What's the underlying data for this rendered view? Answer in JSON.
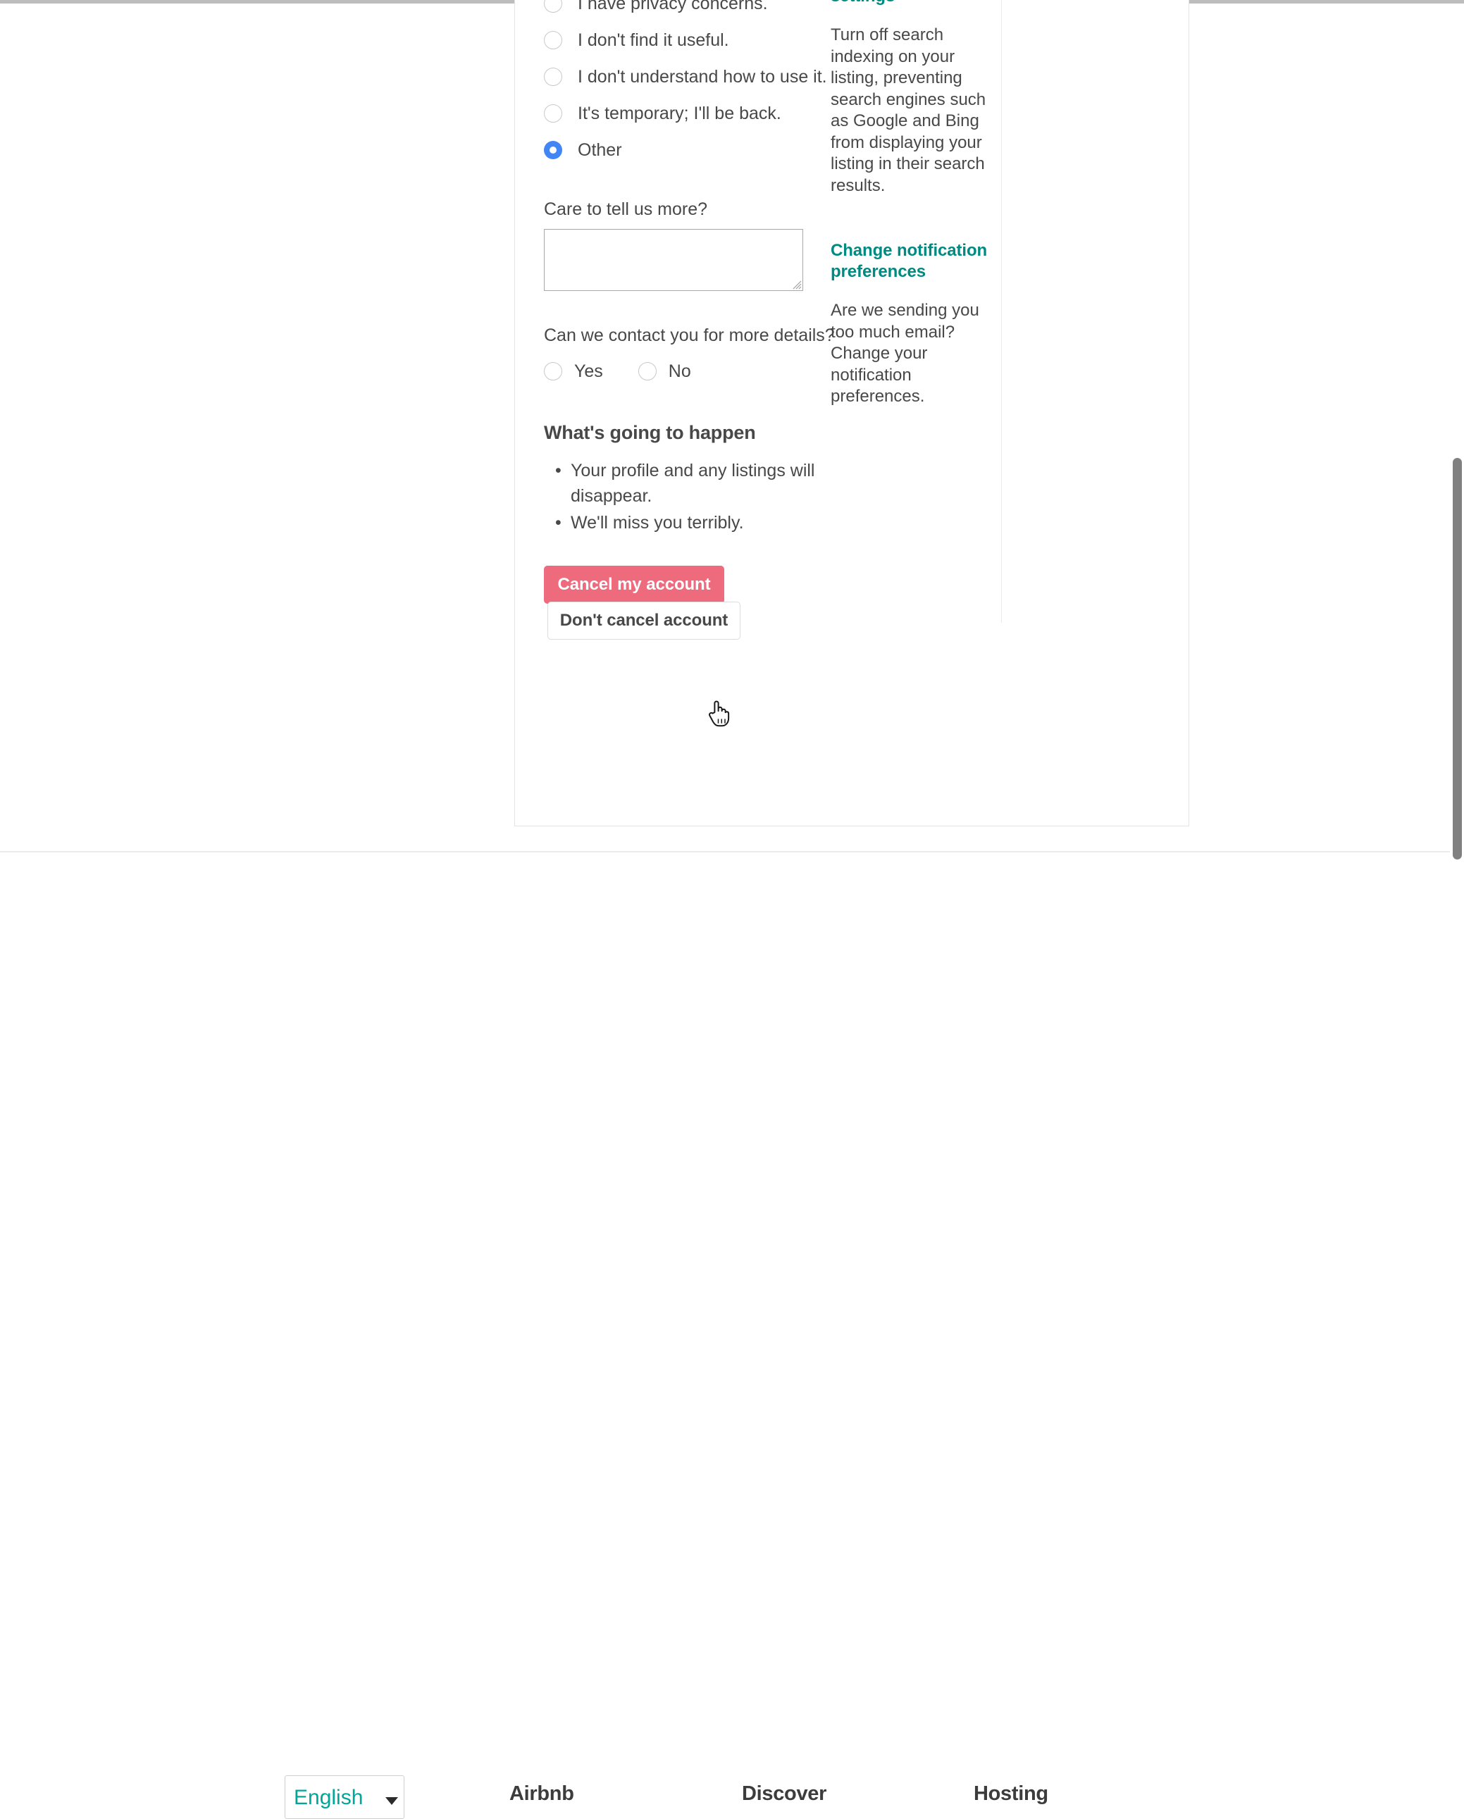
{
  "page": {
    "language_select": {
      "value": "English",
      "options": [
        "English"
      ]
    }
  },
  "card": {
    "reasons": [
      {
        "label": "I have privacy concerns.",
        "selected": false
      },
      {
        "label": "I don't find it useful.",
        "selected": false
      },
      {
        "label": "I don't understand how to use it.",
        "selected": false
      },
      {
        "label": "It's temporary; I'll be back.",
        "selected": false
      },
      {
        "label": "Other",
        "selected": true
      }
    ],
    "more_label": "Care to tell us more?",
    "more_value": "",
    "more_placeholder": "",
    "contact_question": "Can we contact you for more details?",
    "contact_options": [
      {
        "label": "Yes",
        "selected": false
      },
      {
        "label": "No",
        "selected": false
      }
    ],
    "happen_title": "What's going to happen",
    "happen_items": [
      "Your profile and any listings will disappear.",
      "We'll miss you terribly."
    ],
    "cancel_button": "Cancel my account",
    "keep_button": "Don't cancel account"
  },
  "aside": {
    "blocks": [
      {
        "link": "settings",
        "text": "Turn off search indexing on your listing, preventing search engines such as Google and Bing from displaying your listing in their search results."
      },
      {
        "link": "Change notification preferences",
        "text": "Are we sending you too much email? Change your notification preferences."
      }
    ]
  },
  "footer": {
    "columns": [
      {
        "title": "Airbnb"
      },
      {
        "title": "Discover"
      },
      {
        "title": "Hosting"
      }
    ]
  },
  "colors": {
    "accent_teal": "#008a81",
    "select_teal": "#00a699",
    "danger_pink": "#ee6a7d",
    "radio_blue": "#4285f4",
    "text": "#484848"
  }
}
